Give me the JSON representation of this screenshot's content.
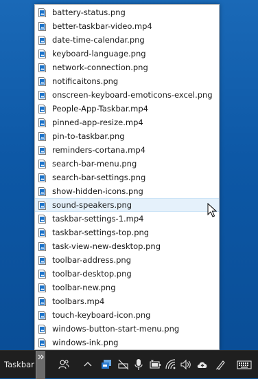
{
  "toolbar": {
    "label": "Taskbar"
  },
  "menu": {
    "hover_index": 14,
    "items": [
      {
        "label": "battery-status.png"
      },
      {
        "label": "better-taskbar-video.mp4"
      },
      {
        "label": "date-time-calendar.png"
      },
      {
        "label": "keyboard-language.png"
      },
      {
        "label": "network-connection.png"
      },
      {
        "label": "notificaitons.png"
      },
      {
        "label": "onscreen-keyboard-emoticons-excel.png"
      },
      {
        "label": "People-App-Taskbar.mp4"
      },
      {
        "label": "pinned-app-resize.mp4"
      },
      {
        "label": "pin-to-taskbar.png"
      },
      {
        "label": "reminders-cortana.mp4"
      },
      {
        "label": "search-bar-menu.png"
      },
      {
        "label": "search-bar-settings.png"
      },
      {
        "label": "show-hidden-icons.png"
      },
      {
        "label": "sound-speakers.png"
      },
      {
        "label": "taskbar-settings-1.mp4"
      },
      {
        "label": "taskbar-settings-top.png"
      },
      {
        "label": "task-view-new-desktop.png"
      },
      {
        "label": "toolbar-address.png"
      },
      {
        "label": "toolbar-desktop.png"
      },
      {
        "label": "toolbar-new.png"
      },
      {
        "label": "toolbars.mp4"
      },
      {
        "label": "touch-keyboard-icon.png"
      },
      {
        "label": "windows-button-start-menu.png"
      },
      {
        "label": "windows-ink.png"
      }
    ]
  },
  "tray": {
    "icons": [
      "people-icon",
      "chevron-up-icon",
      "app-tray-icon",
      "network-disconnected-icon",
      "microphone-icon",
      "battery-icon",
      "wifi-icon",
      "speaker-icon",
      "cloud-upload-icon",
      "pen-icon",
      "keyboard-icon"
    ]
  },
  "colors": {
    "desktop": "#0f5aa3",
    "taskbar": "#1f1f1f",
    "hover": "#e5f1fb",
    "file_icon_blue": "#1c73c9"
  }
}
